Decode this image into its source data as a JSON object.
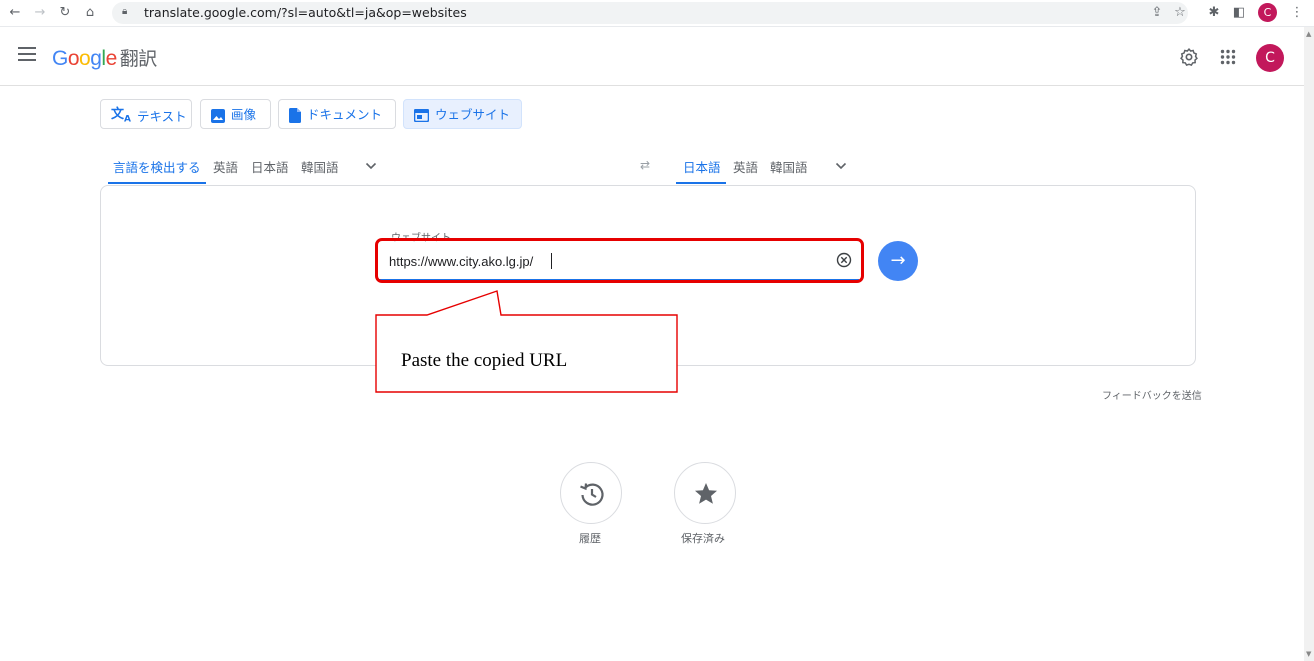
{
  "browser": {
    "url": "translate.google.com/?sl=auto&tl=ja&op=websites",
    "profile_initial": "C"
  },
  "header": {
    "logo_letters": [
      "G",
      "o",
      "o",
      "g",
      "l",
      "e"
    ],
    "app_name": "翻訳",
    "account_initial": "C"
  },
  "modes": [
    {
      "label": "テキスト",
      "icon": "translate-icon"
    },
    {
      "label": "画像",
      "icon": "image-icon"
    },
    {
      "label": "ドキュメント",
      "icon": "document-icon"
    },
    {
      "label": "ウェブサイト",
      "icon": "website-icon",
      "active": true
    }
  ],
  "source_langs": {
    "detect": "言語を検出する",
    "items": [
      "英語",
      "日本語",
      "韓国語"
    ]
  },
  "target_langs": {
    "items": [
      "日本語",
      "英語",
      "韓国語"
    ]
  },
  "website": {
    "field_label": "ウェブサイト",
    "value": "https://www.city.ako.lg.jp/"
  },
  "annotation": {
    "callout_text": "Paste the copied URL",
    "color": "#e60000"
  },
  "feedback": "フィードバックを送信",
  "shortcuts": [
    {
      "label": "履歴",
      "icon": "history-icon"
    },
    {
      "label": "保存済み",
      "icon": "star-icon"
    }
  ],
  "colors": {
    "accent": "#1a73e8",
    "go_button": "#4285f4",
    "avatar": "#c2185b"
  }
}
